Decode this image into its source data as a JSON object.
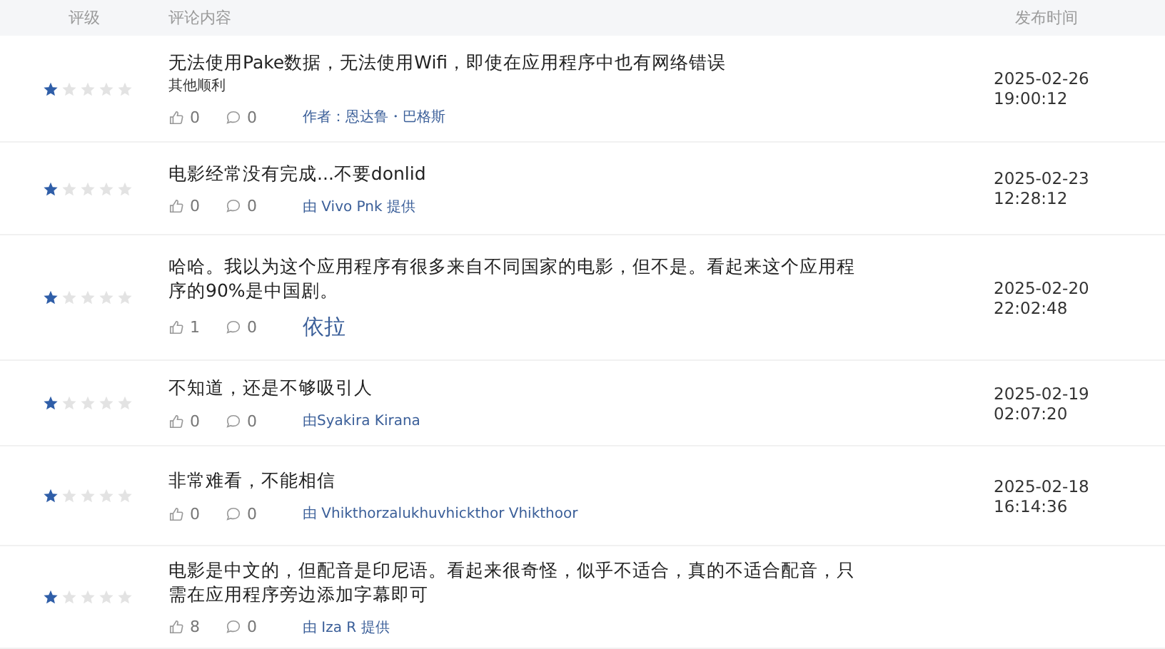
{
  "table": {
    "columns": [
      "评级",
      "评论内容",
      "发布时间"
    ],
    "rows": [
      {
        "stars": 1,
        "text": "无法使用Pake数据，无法使用Wifi，即使在应用程序中也有网络错误",
        "subtext": "其他顺利",
        "likes": "0",
        "comments": "0",
        "author": "作者：恩达鲁・巴格斯",
        "time": "2025-02-26 19:00:12"
      },
      {
        "stars": 1,
        "text": "电影经常没有完成...不要donlid",
        "likes": "0",
        "comments": "0",
        "author": "由 Vivo Pnk 提供",
        "time": "2025-02-23 12:28:12"
      },
      {
        "stars": 1,
        "text": "哈哈。我以为这个应用程序有很多来自不同国家的电影，但不是。看起来这个应用程序的90%是中国剧。",
        "likes": "1",
        "comments": "0",
        "author": "依拉",
        "time": "2025-02-20 22:02:48"
      },
      {
        "stars": 1,
        "text": "不知道，还是不够吸引人",
        "likes": "0",
        "comments": "0",
        "author": "由Syakira Kirana",
        "time": "2025-02-19 02:07:20"
      },
      {
        "stars": 1,
        "text": "非常难看，不能相信",
        "likes": "0",
        "comments": "0",
        "author": "由 Vhikthorzalukhuvhickthor Vhikthoor",
        "time": "2025-02-18 16:14:36"
      },
      {
        "stars": 1,
        "text": "电影是中文的，但配音是印尼语。看起来很奇怪，似乎不适合，真的不适合配音，只需在应用程序旁边添加字幕即可",
        "likes": "8",
        "comments": "0",
        "author": "由 Iza R 提供"
      }
    ]
  }
}
